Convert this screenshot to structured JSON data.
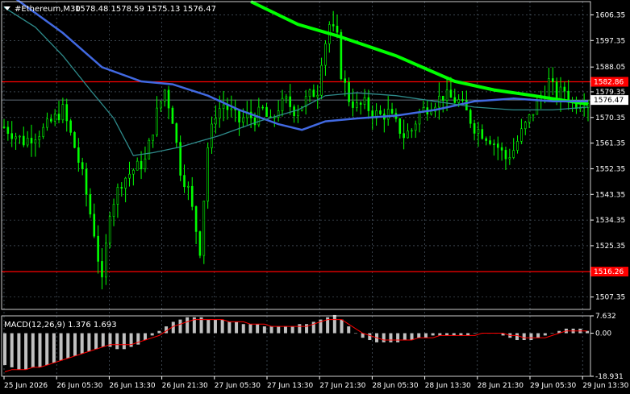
{
  "window": {
    "symbol_timeframe": "#Ethereum,M30",
    "ohlc": "1578.48 1578.59 1575.13 1576.47",
    "menu_icon": "triangle-down-icon"
  },
  "colors": {
    "background": "#000000",
    "grid": "#5f6f7f",
    "candles": "#00ff00",
    "ma_fast": "#00ff00",
    "ma_mid": "#4169e1",
    "ma_slow": "#2e8b8b",
    "level_line": "#ff0000",
    "current_price_line": "#7f8fa0",
    "macd_hist": "#c0c0c0",
    "macd_signal": "#ff0000"
  },
  "chart_data": [
    {
      "type": "candlestick",
      "title": "#Ethereum,M30",
      "ylim": [
        1503.0,
        1611.0
      ],
      "y_ticks": [
        "1606.35",
        "1597.35",
        "1588.05",
        "1579.35",
        "1570.35",
        "1561.35",
        "1552.35",
        "1543.35",
        "1534.35",
        "1525.35",
        "1507.35"
      ],
      "x_ticks": [
        "25 Jun 2026",
        "26 Jun 05:30",
        "26 Jun 13:30",
        "26 Jun 21:30",
        "27 Jun 05:30",
        "27 Jun 13:30",
        "27 Jun 21:30",
        "28 Jun 05:30",
        "28 Jun 13:30",
        "28 Jun 21:30",
        "29 Jun 05:30",
        "29 Jun 13:30"
      ],
      "levels": [
        {
          "value": 1582.86,
          "label": "1582.86",
          "color": "#ff0000"
        },
        {
          "value": 1516.26,
          "label": "1516.26",
          "color": "#ff0000"
        }
      ],
      "current_price": {
        "value": 1576.47,
        "label": "1576.47"
      },
      "close_path": [
        [
          0,
          1567
        ],
        [
          5,
          1562
        ],
        [
          10,
          1566
        ],
        [
          15,
          1573
        ],
        [
          18,
          1560
        ],
        [
          20,
          1550
        ],
        [
          23,
          1530
        ],
        [
          25,
          1512
        ],
        [
          27,
          1538
        ],
        [
          30,
          1548
        ],
        [
          33,
          1552
        ],
        [
          36,
          1555
        ],
        [
          39,
          1572
        ],
        [
          41,
          1580
        ],
        [
          43,
          1570
        ],
        [
          45,
          1552
        ],
        [
          47,
          1545
        ],
        [
          49,
          1531
        ],
        [
          50,
          1524
        ],
        [
          52,
          1560
        ],
        [
          54,
          1572
        ],
        [
          56,
          1575
        ],
        [
          58,
          1572
        ],
        [
          60,
          1569
        ],
        [
          62,
          1571
        ],
        [
          64,
          1570
        ],
        [
          66,
          1573
        ],
        [
          68,
          1568
        ],
        [
          70,
          1574
        ],
        [
          72,
          1576
        ],
        [
          74,
          1573
        ],
        [
          76,
          1575
        ],
        [
          78,
          1578
        ],
        [
          80,
          1580
        ],
        [
          81,
          1591
        ],
        [
          83,
          1603
        ],
        [
          85,
          1598
        ],
        [
          86,
          1586
        ],
        [
          88,
          1577
        ],
        [
          90,
          1574
        ],
        [
          92,
          1575
        ],
        [
          94,
          1572
        ],
        [
          96,
          1571
        ],
        [
          98,
          1572
        ],
        [
          100,
          1568
        ],
        [
          102,
          1564
        ],
        [
          104,
          1566
        ],
        [
          106,
          1572
        ],
        [
          108,
          1574
        ],
        [
          110,
          1576
        ],
        [
          112,
          1578
        ],
        [
          114,
          1577
        ],
        [
          116,
          1576
        ],
        [
          118,
          1572
        ],
        [
          120,
          1567
        ],
        [
          122,
          1565
        ],
        [
          124,
          1563
        ],
        [
          126,
          1560
        ],
        [
          128,
          1556
        ],
        [
          130,
          1559
        ],
        [
          132,
          1565
        ],
        [
          134,
          1570
        ],
        [
          136,
          1575
        ],
        [
          138,
          1580
        ],
        [
          139,
          1583
        ],
        [
          141,
          1578
        ],
        [
          143,
          1580
        ],
        [
          145,
          1575
        ],
        [
          147,
          1576
        ],
        [
          149,
          1576.47
        ]
      ],
      "series": [
        {
          "name": "",
          "color": "#00ff00",
          "points": [
            [
              63,
              1611
            ],
            [
              75,
              1603
            ],
            [
              85,
              1599
            ],
            [
              100,
              1592
            ],
            [
              115,
              1583
            ],
            [
              125,
              1580
            ],
            [
              135,
              1578
            ],
            [
              149,
              1575
            ]
          ]
        },
        {
          "name": "",
          "color": "#4169e1",
          "points": [
            [
              0,
              1615
            ],
            [
              15,
              1600
            ],
            [
              25,
              1588
            ],
            [
              35,
              1583
            ],
            [
              43,
              1582
            ],
            [
              52,
              1578
            ],
            [
              60,
              1573
            ],
            [
              70,
              1568
            ],
            [
              76,
              1566
            ],
            [
              82,
              1569
            ],
            [
              90,
              1570
            ],
            [
              100,
              1571
            ],
            [
              110,
              1573
            ],
            [
              120,
              1576
            ],
            [
              130,
              1577
            ],
            [
              140,
              1576
            ],
            [
              149,
              1576
            ]
          ]
        },
        {
          "name": "",
          "color": "#2e8b8b",
          "points": [
            [
              0,
              1609
            ],
            [
              8,
              1602
            ],
            [
              15,
              1592
            ],
            [
              22,
              1580
            ],
            [
              28,
              1570
            ],
            [
              33,
              1557
            ],
            [
              38,
              1558
            ],
            [
              45,
              1560
            ],
            [
              55,
              1564
            ],
            [
              65,
              1569
            ],
            [
              75,
              1573
            ],
            [
              82,
              1578
            ],
            [
              90,
              1579
            ],
            [
              100,
              1578
            ],
            [
              110,
              1576
            ],
            [
              120,
              1574
            ],
            [
              130,
              1573
            ],
            [
              140,
              1573
            ],
            [
              149,
              1574
            ]
          ]
        }
      ]
    },
    {
      "type": "bar",
      "title": "MACD(12,26,9) 1.376 1.693",
      "ylim": [
        -18.931,
        7.632
      ],
      "y_ticks": [
        "7.632",
        "0.00",
        "-18.931"
      ],
      "histogram": [
        -14,
        -15,
        -16,
        -16,
        -15,
        -15,
        -14,
        -13,
        -12,
        -11,
        -10,
        -9,
        -8,
        -7,
        -6,
        -6,
        -7,
        -7,
        -6,
        -5,
        -3,
        -1,
        1,
        3,
        5,
        6,
        7,
        7,
        7,
        6,
        6,
        6,
        5,
        5,
        4,
        4,
        4,
        3,
        3,
        3,
        3,
        3,
        4,
        4,
        5,
        6,
        7,
        8,
        6,
        3,
        0,
        -2,
        -3,
        -4,
        -4,
        -4,
        -4,
        -3,
        -3,
        -2,
        -2,
        -1,
        -1,
        -1,
        -1,
        -1,
        -1,
        0,
        0,
        0,
        0,
        -1,
        -2,
        -3,
        -3,
        -3,
        -2,
        -1,
        0,
        1,
        2,
        2,
        2,
        1
      ],
      "signal": [
        -17,
        -16,
        -16,
        -16,
        -15,
        -15,
        -14,
        -13,
        -12,
        -11,
        -10,
        -9,
        -8,
        -7,
        -6,
        -5,
        -5,
        -5,
        -5,
        -4,
        -3,
        -2,
        -1,
        1,
        3,
        4,
        5,
        6,
        6,
        6,
        6,
        6,
        5,
        5,
        5,
        4,
        4,
        4,
        3,
        3,
        3,
        3,
        3,
        3,
        4,
        5,
        6,
        6,
        6,
        4,
        2,
        0,
        -1,
        -2,
        -3,
        -3,
        -3,
        -3,
        -3,
        -2,
        -2,
        -2,
        -1,
        -1,
        -1,
        -1,
        -1,
        -1,
        0,
        0,
        0,
        0,
        -1,
        -1,
        -2,
        -2,
        -2,
        -2,
        -1,
        0,
        1,
        1,
        1,
        1
      ]
    }
  ]
}
